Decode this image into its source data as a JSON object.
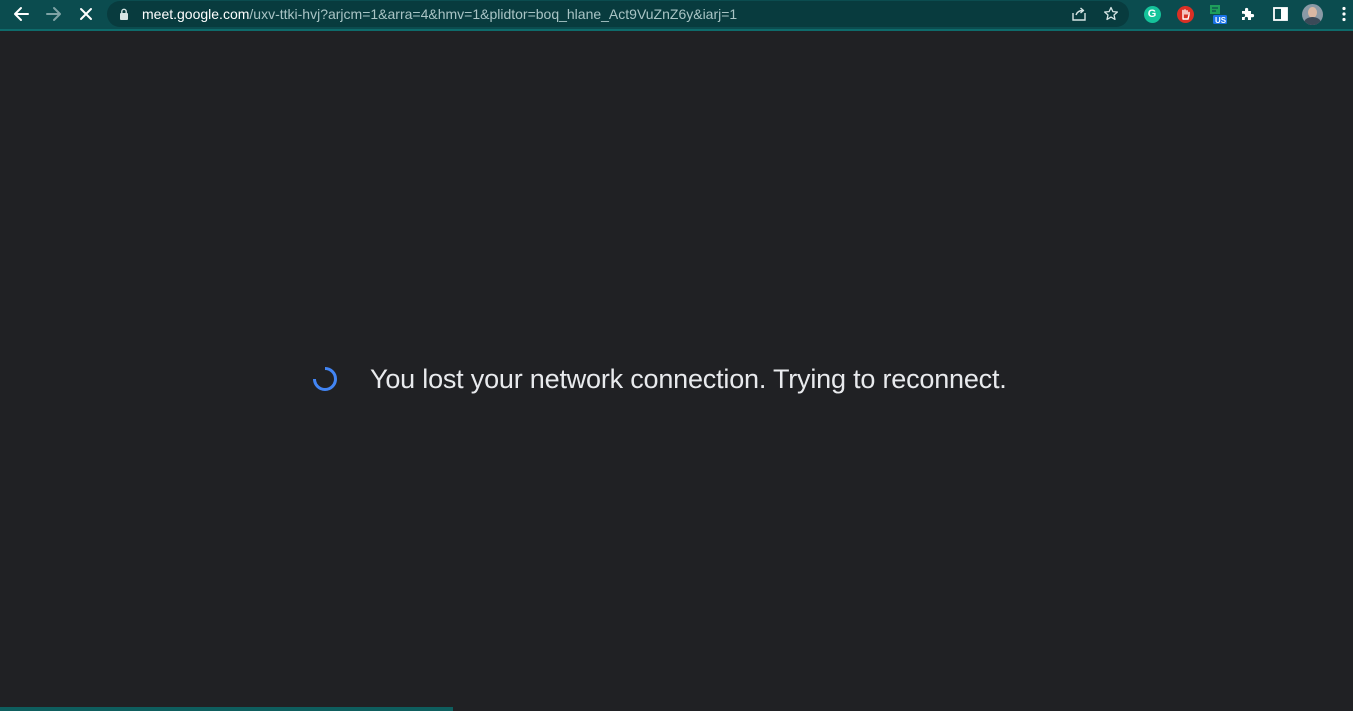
{
  "browser": {
    "url_host": "meet.google.com",
    "url_path": "/uxv-ttki-hvj?arjcm=1&arra=4&hmv=1&plidtor=boq_hlane_Act9VuZnZ6y&iarj=1",
    "icons": {
      "back": "back-arrow-icon",
      "forward": "forward-arrow-icon",
      "stop": "stop-loading-icon",
      "lock": "lock-icon",
      "share": "share-icon",
      "bookmark": "star-icon",
      "extensions": [
        "grammarly-icon",
        "adblock-icon",
        "vpn-extension-icon",
        "puzzle-icon",
        "side-panel-icon"
      ],
      "profile": "avatar",
      "menu": "kebab-menu-icon"
    },
    "grammarly_label": "G",
    "vpn_badge": "US",
    "accent_color": "#0b4c4f"
  },
  "page": {
    "message": "You lost your network connection. Trying to reconnect.",
    "spinner_color": "#4285f4",
    "background_color": "#202124",
    "load_progress": 0.335
  }
}
